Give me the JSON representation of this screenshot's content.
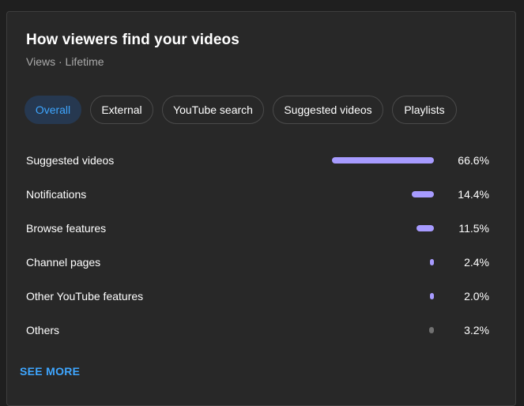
{
  "card": {
    "title": "How viewers find your videos",
    "subtitle": "Views · Lifetime",
    "see_more": "SEE MORE"
  },
  "tabs": [
    {
      "label": "Overall",
      "active": true
    },
    {
      "label": "External",
      "active": false
    },
    {
      "label": "YouTube search",
      "active": false
    },
    {
      "label": "Suggested videos",
      "active": false
    },
    {
      "label": "Playlists",
      "active": false
    }
  ],
  "rows": [
    {
      "label": "Suggested videos",
      "value": "66.6%",
      "percent": 66.6
    },
    {
      "label": "Notifications",
      "value": "14.4%",
      "percent": 14.4
    },
    {
      "label": "Browse features",
      "value": "11.5%",
      "percent": 11.5
    },
    {
      "label": "Channel pages",
      "value": "2.4%",
      "percent": 2.4
    },
    {
      "label": "Other YouTube features",
      "value": "2.0%",
      "percent": 2.0
    },
    {
      "label": "Others",
      "value": "3.2%",
      "percent": 3.2
    }
  ],
  "colors": {
    "bar_accent": "#a79bff",
    "bar_others": "#717171",
    "link": "#3ea6ff",
    "active_tab_bg": "#263850"
  }
}
